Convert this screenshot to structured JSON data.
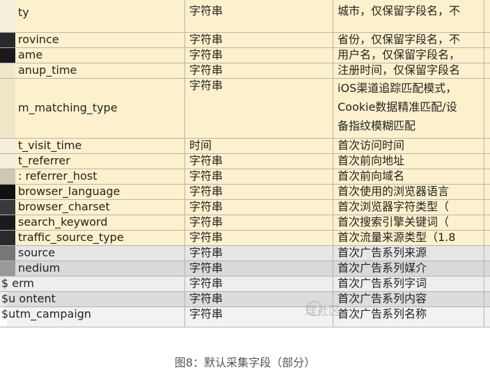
{
  "table": {
    "rows": [
      {
        "name": "ty",
        "type": "字符串",
        "desc": [
          "城市，仅保留字段名，不"
        ],
        "bg": "#fcf1cc",
        "pixel": "#f5eedb"
      },
      {
        "name": "rovince",
        "type": "字符串",
        "desc": [
          "省份，仅保留字段名，不"
        ],
        "bg": "#fcf1cc",
        "pixel": "#2a2a2a"
      },
      {
        "name": "ame",
        "type": "字符串",
        "desc": [
          "用户名，仅保留字段名，"
        ],
        "bg": "#fcf1cc",
        "pixel": "#1a1a1a"
      },
      {
        "name": "anup_time",
        "type": "字符串",
        "desc": [
          "注册时间，仅保留字段名"
        ],
        "bg": "#fcf1cc",
        "pixel": "#f0e6c8"
      },
      {
        "name": "m_matching_type",
        "type": "字符串",
        "desc": [
          "iOS渠道追踪匹配模式，",
          "Cookie数据精准匹配/设",
          "备指纹模糊匹配"
        ],
        "bg": "#fcf1cc",
        "pixel": "#f0e6c8"
      },
      {
        "name": "t_visit_time",
        "type": "时间",
        "desc": [
          "首次访问时间"
        ],
        "bg": "#fcf1cc",
        "pixel": "#f5eedb"
      },
      {
        "name": "t_referrer",
        "type": "字符串",
        "desc": [
          "首次前向地址"
        ],
        "bg": "#fcf1cc",
        "pixel": "#f5eedb"
      },
      {
        "name": ": referrer_host",
        "type": "字符串",
        "desc": [
          "首次前向域名"
        ],
        "bg": "#fcf1cc",
        "pixel": "#cfc8b2"
      },
      {
        "name": "browser_language",
        "type": "字符串",
        "desc": [
          "首次使用的浏览器语言"
        ],
        "bg": "#fcf1cc",
        "pixel": "#111111"
      },
      {
        "name": "browser_charset",
        "type": "字符串",
        "desc": [
          "首次浏览器字符类型（"
        ],
        "bg": "#fcf1cc",
        "pixel": "#3a3a3a"
      },
      {
        "name": "search_keyword",
        "type": "字符串",
        "desc": [
          "首次搜索引擎关键词（"
        ],
        "bg": "#fcf1cc",
        "pixel": "#1a1a1a"
      },
      {
        "name": "traffic_source_type",
        "type": "字符串",
        "desc": [
          "首次流量来源类型（1.8"
        ],
        "bg": "#fcf1cc",
        "pixel": "#2a2a2a"
      },
      {
        "name": "source",
        "type": "字符串",
        "desc": [
          "首次广告系列来源"
        ],
        "bg": "#e6e6e6",
        "pixel": "#777777"
      },
      {
        "name": "nedium",
        "type": "字符串",
        "desc": [
          "首次广告系列媒介"
        ],
        "bg": "#d9d9d9",
        "pixel": "#9a9a9a"
      },
      {
        "name": "$  erm",
        "type": "字符串",
        "desc": [
          "首次广告系列字词"
        ],
        "bg": "#eeeeee",
        "pixel": "#e8e8e8"
      },
      {
        "name": "$u   ontent",
        "type": "字符串",
        "desc": [
          "首次广告系列内容"
        ],
        "bg": "#dcdcdc",
        "pixel": "#ececec"
      },
      {
        "name": "$utm_campaign",
        "type": "字符串",
        "desc": [
          "首次广告系列名称"
        ],
        "bg": "#f2f2f2",
        "pixel": "#ffffff"
      }
    ]
  },
  "watermark": "理社区",
  "caption": "图8：默认采集字段（部分）"
}
